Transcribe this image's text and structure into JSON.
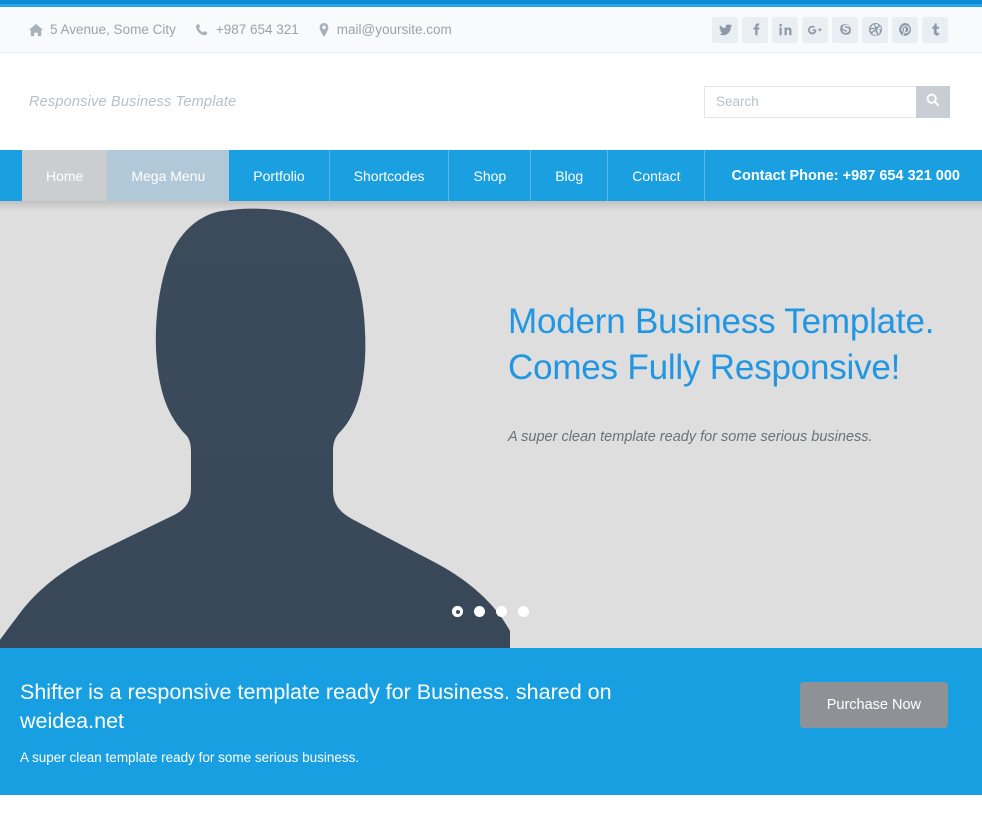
{
  "theme": {
    "primary_blue": "#1a9fe0",
    "accent_dark_blue": "#0c8bd4",
    "hero_bg": "#dedede",
    "silhouette": "#3c4c5c",
    "muted_gray": "#9aa3ab",
    "button_gray": "#8e9296"
  },
  "topbar": {
    "contacts": [
      {
        "icon": "home-icon",
        "text": "5 Avenue, Some City"
      },
      {
        "icon": "phone-icon",
        "text": "+987 654 321"
      },
      {
        "icon": "map-pin-icon",
        "text": "mail@yoursite.com"
      }
    ],
    "social": [
      {
        "name": "twitter-icon",
        "glyph": "t"
      },
      {
        "name": "facebook-icon",
        "glyph": "f"
      },
      {
        "name": "linkedin-icon",
        "glyph": "in"
      },
      {
        "name": "google-plus-icon",
        "glyph": "g+"
      },
      {
        "name": "skype-icon",
        "glyph": "s"
      },
      {
        "name": "dribbble-icon",
        "glyph": "d"
      },
      {
        "name": "pinterest-icon",
        "glyph": "p"
      },
      {
        "name": "tumblr-icon",
        "glyph": "t"
      }
    ]
  },
  "branding": {
    "logo_text": "Responsive Business Template"
  },
  "search": {
    "placeholder": "Search",
    "value": "",
    "icon": "search-icon"
  },
  "nav": {
    "items": [
      {
        "label": "Home",
        "state": "active-gray"
      },
      {
        "label": "Mega Menu",
        "state": "active-blue"
      },
      {
        "label": "Portfolio",
        "state": ""
      },
      {
        "label": "Shortcodes",
        "state": ""
      },
      {
        "label": "Shop",
        "state": ""
      },
      {
        "label": "Blog",
        "state": ""
      },
      {
        "label": "Contact",
        "state": ""
      }
    ],
    "phone": "Contact Phone: +987 654 321 000"
  },
  "hero": {
    "title_line1": "Modern Business Template.",
    "title_line2": "Comes Fully Responsive!",
    "subtitle": "A super clean template ready for some serious business.",
    "image_alt": "person-silhouette",
    "slides_total": 4,
    "slide_current": 1
  },
  "cta": {
    "title": "Shifter is a responsive template ready for Business. shared on weidea.net",
    "subtitle": "A super clean template ready for some serious business.",
    "button_label": "Purchase Now"
  }
}
